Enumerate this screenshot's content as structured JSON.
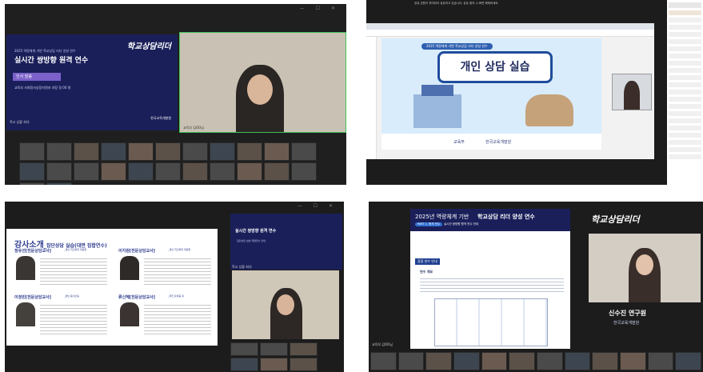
{
  "panel1": {
    "subtitle": "2025 역량체계 기반 학교상담 리더 양성 연수",
    "title": "실시간 쌍방향 원격 연수",
    "section_tag": "인사 말씀",
    "speaker_line": "교육부 사회정서성장지원과 과장 정 00 명",
    "logo_text": "학교상담리더",
    "org": "한국교육개발원",
    "label_left": "학교 상황 회의",
    "label_right": "교육부 김OO님"
  },
  "panel2": {
    "slide_banner": "2025 역량체계 기반 학교상담 리더 양성 연수",
    "slide_title": "개인 상담 실습",
    "ministry": "교육부",
    "institute": "한국교육개발원",
    "notice": "공유 권한이 부여되어 공유하고 있습니다. 공유 중지 시 화면 해제하세요."
  },
  "panel3": {
    "slide_title": "강사소개",
    "slide_subtitle": "_집단상담 실습(대면 집합연수)",
    "instructors": [
      {
        "name": "정유선[전문상담교사]",
        "school": "_경남 학교폭력 위원회"
      },
      {
        "name": "이지원[전문상담교사]",
        "school": "_경남 학교폭력 위원회"
      },
      {
        "name": "이정빈[전문상담교사]",
        "school": "_경남 동서초등"
      },
      {
        "name": "류신혜[전문상담교사]",
        "school": "_대전 유성중 외"
      }
    ],
    "mini_title": "실시간 쌍방향 원격 연수",
    "mini_subtitle": "집단상담 실습 대면연수 안내",
    "label_bottom": "학교 상황 회의"
  },
  "panel4": {
    "title_year": "2025년 역량체계 기반",
    "title_main": "학교상담 리더 양성 연수",
    "part_tag": "PART 1. 원격 연수",
    "part_title": "실시간 쌍방향 원격 연수 안내",
    "section_label": "참합 연수 안내",
    "item": "연수 개요",
    "logo_text": "학교상담리더",
    "speaker_name": "신수진 연구원",
    "speaker_org": "한국교육개발원",
    "label_bottom": "교육부 김OO님"
  }
}
